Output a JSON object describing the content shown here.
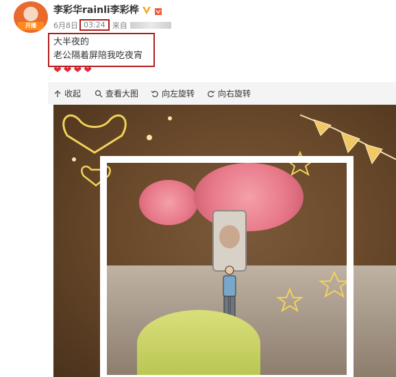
{
  "post": {
    "author_name": "李彩华rainli李彩桦",
    "avatar_badge": "开播",
    "date": "6月8日",
    "time": "03:24",
    "source_prefix": "来自",
    "text_lines": [
      "大半夜的",
      "老公隔着屏陪我吃夜宵"
    ],
    "hearts": [
      "❤",
      "❤",
      "❤",
      "❤"
    ]
  },
  "toolbar": {
    "collapse_label": "收起",
    "view_large_label": "查看大图",
    "rotate_left_label": "向左旋转",
    "rotate_right_label": "向右旋转"
  },
  "icons": {
    "verified": "verified-v-icon",
    "crown": "crown-icon",
    "collapse": "arrow-up-icon",
    "zoom": "zoom-icon",
    "rotate_left": "rotate-left-icon",
    "rotate_right": "rotate-right-icon"
  },
  "colors": {
    "highlight_box": "#b11b1b",
    "heart": "#e0293b",
    "toolbar_bg": "#f4f4f4",
    "photo_bg": "#6b4a2b"
  }
}
